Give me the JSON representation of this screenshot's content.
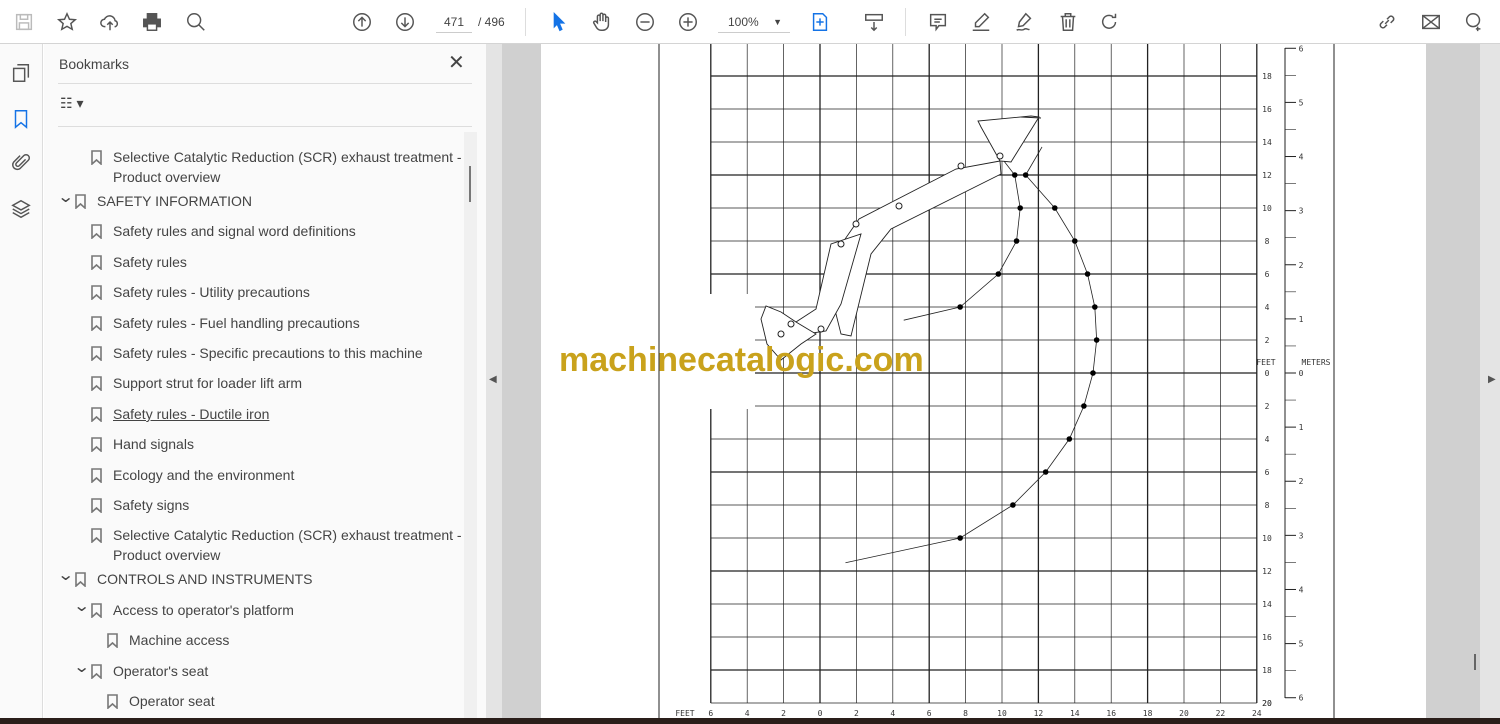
{
  "toolbar": {
    "page_current": "471",
    "page_total": "/ 496",
    "zoom": "100%",
    "icons": [
      "save-icon",
      "bookmark-star-icon",
      "cloud-upload-icon",
      "print-icon",
      "find-icon",
      "page-up-icon",
      "page-down-icon",
      "select-cursor-icon",
      "hand-icon",
      "zoom-out-icon",
      "zoom-in-icon",
      "fit-page-icon",
      "scroll-mode-icon",
      "comment-icon",
      "highlight-icon",
      "sign-icon",
      "delete-icon",
      "rotate-icon",
      "share-link-icon",
      "email-icon",
      "add-user-icon"
    ],
    "accent": "#1473e6"
  },
  "panel": {
    "title": "Bookmarks",
    "close": "✕",
    "options": "☷ ▾",
    "items": [
      {
        "label": "Selective Catalytic Reduction (SCR) exhaust treatment -",
        "label2": "Product overview",
        "level": 1
      },
      {
        "label": "SAFETY INFORMATION",
        "level": 0,
        "expanded": true
      },
      {
        "label": "Safety rules and signal word definitions",
        "level": 1
      },
      {
        "label": "Safety rules",
        "level": 1
      },
      {
        "label": "Safety rules - Utility precautions",
        "level": 1
      },
      {
        "label": "Safety rules - Fuel handling precautions",
        "level": 1
      },
      {
        "label": "Safety rules - Specific precautions to this machine",
        "level": 1
      },
      {
        "label": "Support strut for loader lift arm",
        "level": 1
      },
      {
        "label": "Safety rules - Ductile iron",
        "level": 1,
        "underline": true
      },
      {
        "label": "Hand signals",
        "level": 1
      },
      {
        "label": "Ecology and the environment",
        "level": 1
      },
      {
        "label": "Safety signs",
        "level": 1
      },
      {
        "label": "Selective Catalytic Reduction (SCR) exhaust treatment -",
        "label2": "Product overview",
        "level": 1
      },
      {
        "label": "CONTROLS AND INSTRUMENTS",
        "level": 0,
        "expanded": true
      },
      {
        "label": "Access to operator's platform",
        "level": 1,
        "expanded": true
      },
      {
        "label": "Machine access",
        "level": 2
      },
      {
        "label": "Operator's seat",
        "level": 1,
        "expanded": true
      },
      {
        "label": "Operator seat",
        "level": 2
      }
    ]
  },
  "document": {
    "watermark": "machinecatalogic.com",
    "x_axis_label": "FEET",
    "y_axis_label": "FEET",
    "meters_label": "METERS",
    "x_ticks_ft": [
      -6,
      -4,
      -2,
      0,
      2,
      4,
      6,
      8,
      10,
      12,
      14,
      16,
      18,
      20,
      22,
      24
    ],
    "y_ticks_ft": [
      18,
      16,
      14,
      12,
      10,
      8,
      6,
      4,
      2,
      0,
      -2,
      -4,
      -6,
      -8,
      -10,
      -12,
      -14,
      -16,
      -18,
      -20
    ],
    "meter_ticks": [
      6,
      5,
      4,
      3,
      2,
      1,
      0,
      -1,
      -2,
      -3,
      -4,
      -5,
      -6
    ],
    "reach_points_ft": [
      [
        10.7,
        12
      ],
      [
        11.3,
        12
      ],
      [
        11.0,
        10
      ],
      [
        12.9,
        10
      ],
      [
        10.8,
        8
      ],
      [
        14.0,
        8
      ],
      [
        9.8,
        6
      ],
      [
        14.7,
        6
      ],
      [
        7.7,
        4
      ],
      [
        15.1,
        4
      ],
      [
        15.2,
        2
      ],
      [
        15.0,
        0
      ],
      [
        14.5,
        -2
      ],
      [
        13.7,
        -4
      ],
      [
        12.4,
        -6
      ],
      [
        10.6,
        -8
      ],
      [
        7.7,
        -10
      ]
    ]
  }
}
